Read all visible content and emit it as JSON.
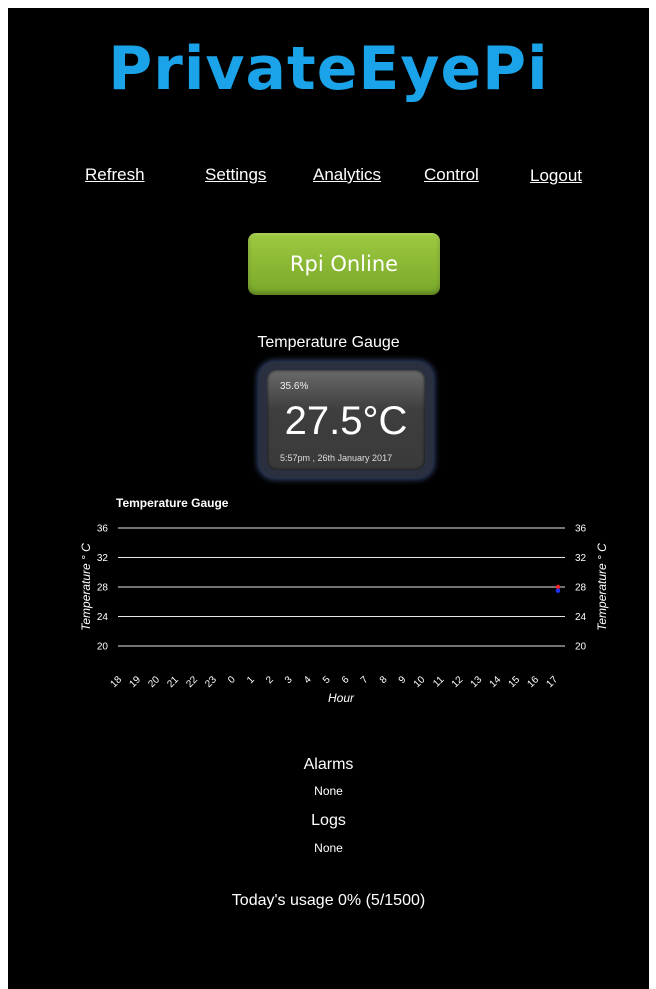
{
  "app": {
    "title": "PrivateEyePi"
  },
  "nav": [
    {
      "label": "Refresh"
    },
    {
      "label": "Settings"
    },
    {
      "label": "Analytics"
    },
    {
      "label": "Control"
    },
    {
      "label": "Logout"
    }
  ],
  "status": {
    "label": "Rpi Online",
    "color": "#8ab935"
  },
  "gauge": {
    "title": "Temperature Gauge",
    "humidity": "35.6%",
    "temperature": "27.5°C",
    "timestamp": "5:57pm , 26th January 2017"
  },
  "chart_data": {
    "type": "line",
    "title": "Temperature Gauge",
    "xlabel": "Hour",
    "ylabel": "Temperature ° C",
    "categories": [
      "18",
      "19",
      "20",
      "21",
      "22",
      "23",
      "0",
      "1",
      "2",
      "3",
      "4",
      "5",
      "6",
      "7",
      "8",
      "9",
      "10",
      "11",
      "12",
      "13",
      "14",
      "15",
      "16",
      "17"
    ],
    "yticks": [
      36,
      32,
      28,
      24,
      20
    ],
    "ylim": [
      20,
      36
    ],
    "grid": true,
    "series": [
      {
        "color": "#ff2222",
        "points": [
          {
            "x": "17",
            "y": 28.0
          }
        ]
      },
      {
        "color": "#2233ff",
        "points": [
          {
            "x": "17",
            "y": 27.5
          }
        ]
      }
    ]
  },
  "alarms": {
    "heading": "Alarms",
    "value": "None"
  },
  "logs": {
    "heading": "Logs",
    "value": "None"
  },
  "usage": {
    "text": "Today's usage 0% (5/1500)"
  }
}
